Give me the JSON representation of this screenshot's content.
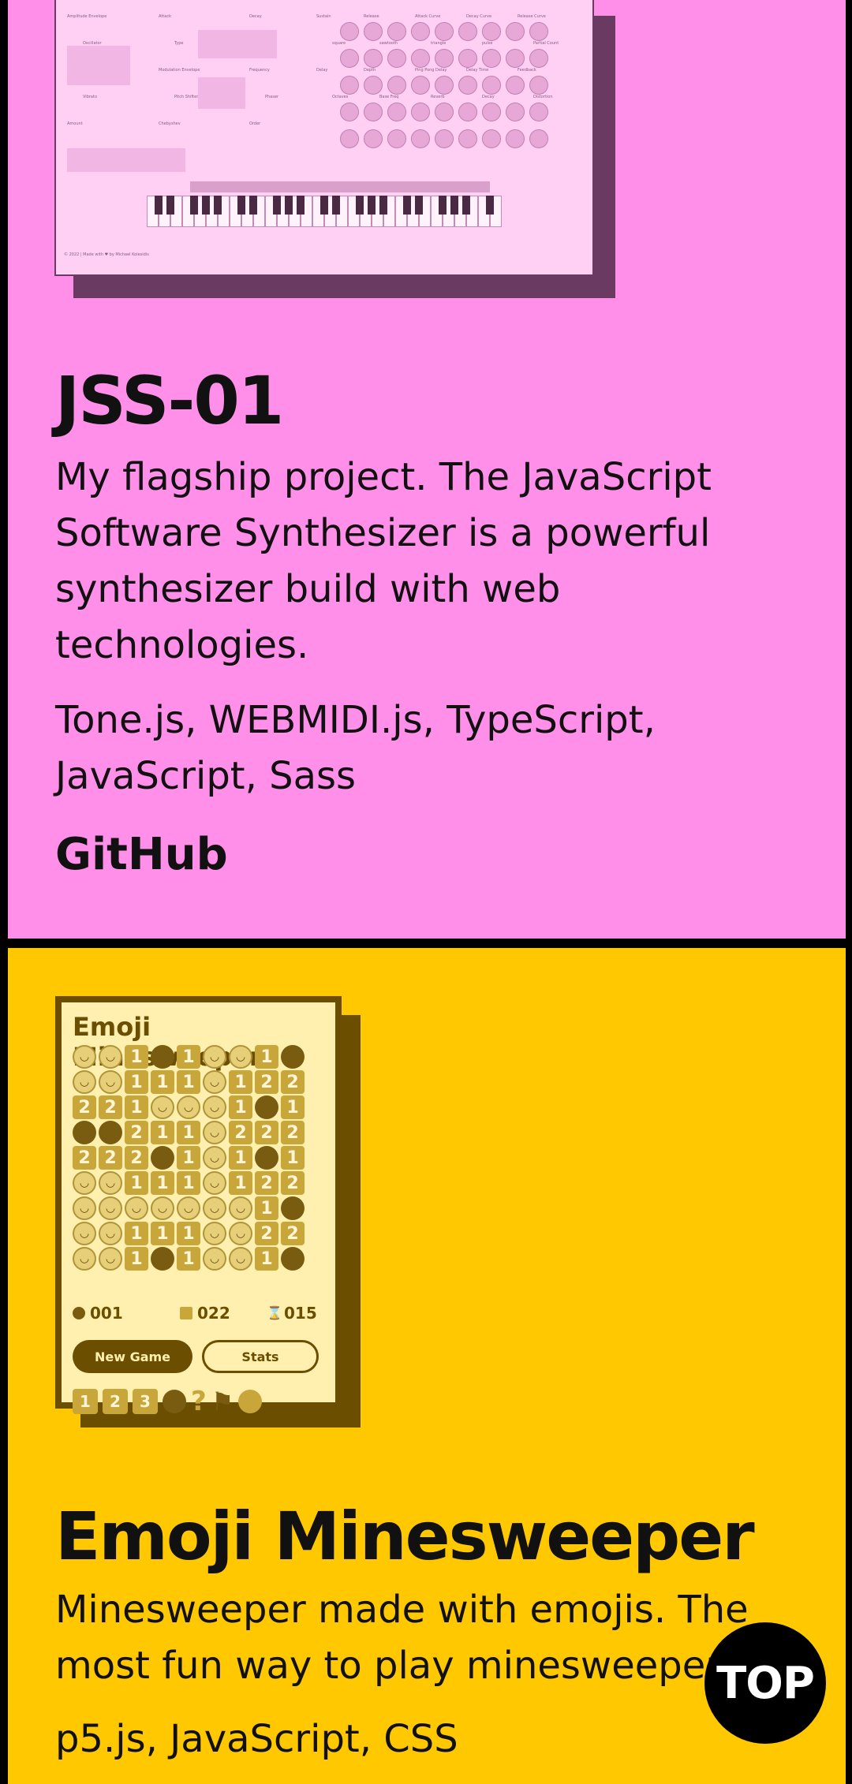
{
  "projects": [
    {
      "title": "JSS-01",
      "description": "My flagship project. The JavaScript Software Synthesizer is a powerful synthesizer build with web technologies.",
      "technologies": "Tone.js, WEBMIDI.js, TypeScript, JavaScript, Sass",
      "link_label": "GitHub",
      "background": "#ff8fe8"
    },
    {
      "title": "Emoji Minesweeper",
      "description": "Minesweeper made with emojis. The most fun way to play minesweeper.",
      "technologies": "p5.js, JavaScript, CSS",
      "background": "#ffc800"
    }
  ],
  "synth_screenshot": {
    "labels": [
      "Amplitude Envelope",
      "Attack",
      "Decay",
      "Sustain",
      "Release",
      "Attack Curve",
      "Decay Curve",
      "Release Curve",
      "Oscillator",
      "Type",
      "sine",
      "square",
      "sawtooth",
      "triangle",
      "pulse",
      "Partial Count",
      "Partials",
      "Modulation Envelope",
      "Frequency",
      "Delay",
      "Depth",
      "Ping Pong Delay",
      "Delay Time",
      "Feedback",
      "Vibrato",
      "Pitch Shifter",
      "Phaser",
      "Octaves",
      "Base Freq",
      "Reverb",
      "Decay",
      "Distortion",
      "Amount",
      "Chebyshev",
      "Order"
    ],
    "footer": "© 2022 | Made with ♥ by Michael Kolesidis"
  },
  "minesweeper_screenshot": {
    "title": "Emoji Minesweeper",
    "grid": [
      [
        "f",
        "f",
        "1",
        "b",
        "1",
        "f",
        "f",
        "1",
        "b"
      ],
      [
        "f",
        "f",
        "1",
        "1",
        "1",
        "f",
        "1",
        "2",
        "2"
      ],
      [
        "2",
        "2",
        "1",
        "f",
        "f",
        "f",
        "1",
        "b",
        "1"
      ],
      [
        "b",
        "b",
        "2",
        "1",
        "1",
        "f",
        "2",
        "2",
        "2"
      ],
      [
        "2",
        "2",
        "2",
        "b",
        "1",
        "f",
        "1",
        "b",
        "1"
      ],
      [
        "f",
        "f",
        "1",
        "1",
        "1",
        "f",
        "1",
        "2",
        "2"
      ],
      [
        "f",
        "f",
        "f",
        "f",
        "f",
        "f",
        "f",
        "1",
        "b"
      ],
      [
        "f",
        "f",
        "1",
        "1",
        "1",
        "f",
        "f",
        "2",
        "2"
      ],
      [
        "f",
        "f",
        "1",
        "b",
        "1",
        "f",
        "f",
        "1",
        "b"
      ]
    ],
    "mines": "001",
    "flags": "022",
    "time": "015",
    "new_game_label": "New Game",
    "stats_label": "Stats",
    "tools": [
      "1",
      "2",
      "3"
    ],
    "help": "?"
  },
  "top_button_label": "TOP",
  "colors": {
    "pink": "#ff8fe8",
    "yellow": "#ffc800",
    "dark_brown": "#6b4e00",
    "black": "#000000"
  }
}
